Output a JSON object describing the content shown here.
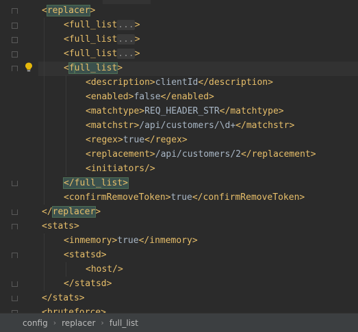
{
  "editor": {
    "lines": [
      {
        "indent": 1,
        "parts": [
          {
            "t": "<",
            "c": "tag"
          },
          {
            "t": "replacer",
            "c": "hl"
          },
          {
            "t": ">",
            "c": "tag"
          }
        ]
      },
      {
        "indent": 2,
        "parts": [
          {
            "t": "<full_list",
            "c": "tag"
          },
          {
            "t": "...",
            "c": "dots"
          },
          {
            "t": ">",
            "c": "tag"
          }
        ]
      },
      {
        "indent": 2,
        "parts": [
          {
            "t": "<full_list",
            "c": "tag"
          },
          {
            "t": "...",
            "c": "dots"
          },
          {
            "t": ">",
            "c": "tag"
          }
        ]
      },
      {
        "indent": 2,
        "parts": [
          {
            "t": "<full_list",
            "c": "tag"
          },
          {
            "t": "...",
            "c": "dots"
          },
          {
            "t": ">",
            "c": "tag"
          }
        ]
      },
      {
        "indent": 2,
        "parts": [
          {
            "t": "<",
            "c": "tag"
          },
          {
            "t": "f",
            "c": "hl"
          },
          {
            "caret": true
          },
          {
            "t": "ull_list",
            "c": "hl"
          },
          {
            "t": ">",
            "c": "tag"
          }
        ]
      },
      {
        "indent": 3,
        "parts": [
          {
            "t": "<description>",
            "c": "tag"
          },
          {
            "t": "clientId",
            "c": "txt"
          },
          {
            "t": "</description>",
            "c": "tag"
          }
        ]
      },
      {
        "indent": 3,
        "parts": [
          {
            "t": "<enabled>",
            "c": "tag"
          },
          {
            "t": "false",
            "c": "txt"
          },
          {
            "t": "</enabled>",
            "c": "tag"
          }
        ]
      },
      {
        "indent": 3,
        "parts": [
          {
            "t": "<matchtype>",
            "c": "tag"
          },
          {
            "t": "REQ_HEADER_STR",
            "c": "txt"
          },
          {
            "t": "</matchtype>",
            "c": "tag"
          }
        ]
      },
      {
        "indent": 3,
        "parts": [
          {
            "t": "<matchstr>",
            "c": "tag"
          },
          {
            "t": "/api/customers/\\d+",
            "c": "txt"
          },
          {
            "t": "</matchstr>",
            "c": "tag"
          }
        ]
      },
      {
        "indent": 3,
        "parts": [
          {
            "t": "<regex>",
            "c": "tag"
          },
          {
            "t": "true",
            "c": "txt"
          },
          {
            "t": "</regex>",
            "c": "tag"
          }
        ]
      },
      {
        "indent": 3,
        "parts": [
          {
            "t": "<replacement>",
            "c": "tag"
          },
          {
            "t": "/api/customers/2",
            "c": "txt"
          },
          {
            "t": "</replacement>",
            "c": "tag"
          }
        ]
      },
      {
        "indent": 3,
        "parts": [
          {
            "t": "<initiators/>",
            "c": "tag"
          }
        ]
      },
      {
        "indent": 2,
        "parts": [
          {
            "t": "</full_list>",
            "c": "hl"
          }
        ]
      },
      {
        "indent": 2,
        "parts": [
          {
            "t": "<confirmRemoveToken>",
            "c": "tag"
          },
          {
            "t": "true",
            "c": "txt"
          },
          {
            "t": "</confirmRemoveToken>",
            "c": "tag"
          }
        ]
      },
      {
        "indent": 1,
        "parts": [
          {
            "t": "</",
            "c": "tag"
          },
          {
            "t": "replacer",
            "c": "hl"
          },
          {
            "t": ">",
            "c": "tag"
          }
        ]
      },
      {
        "indent": 1,
        "parts": [
          {
            "t": "<stats>",
            "c": "tag"
          }
        ]
      },
      {
        "indent": 2,
        "parts": [
          {
            "t": "<inmemory>",
            "c": "tag"
          },
          {
            "t": "true",
            "c": "txt"
          },
          {
            "t": "</inmemory>",
            "c": "tag"
          }
        ]
      },
      {
        "indent": 2,
        "parts": [
          {
            "t": "<statsd>",
            "c": "tag"
          }
        ]
      },
      {
        "indent": 3,
        "parts": [
          {
            "t": "<host/>",
            "c": "tag"
          }
        ]
      },
      {
        "indent": 2,
        "parts": [
          {
            "t": "</statsd>",
            "c": "tag"
          }
        ]
      },
      {
        "indent": 1,
        "parts": [
          {
            "t": "</stats>",
            "c": "tag"
          }
        ]
      },
      {
        "indent": 1,
        "parts": [
          {
            "t": "<bruteforce>",
            "c": "tag"
          }
        ]
      }
    ],
    "gutter_icons": [
      {
        "line": 4,
        "icon": "lightbulb-icon"
      }
    ],
    "colors": {
      "background": "#2b2b2b",
      "tag": "#e8bf6a",
      "text": "#a9b7c6",
      "match_highlight": "#3b514d",
      "lightbulb": "#e5b80b"
    }
  },
  "breadcrumb": {
    "items": [
      "config",
      "replacer",
      "full_list"
    ],
    "separator_icon": "chevron-right-icon"
  }
}
